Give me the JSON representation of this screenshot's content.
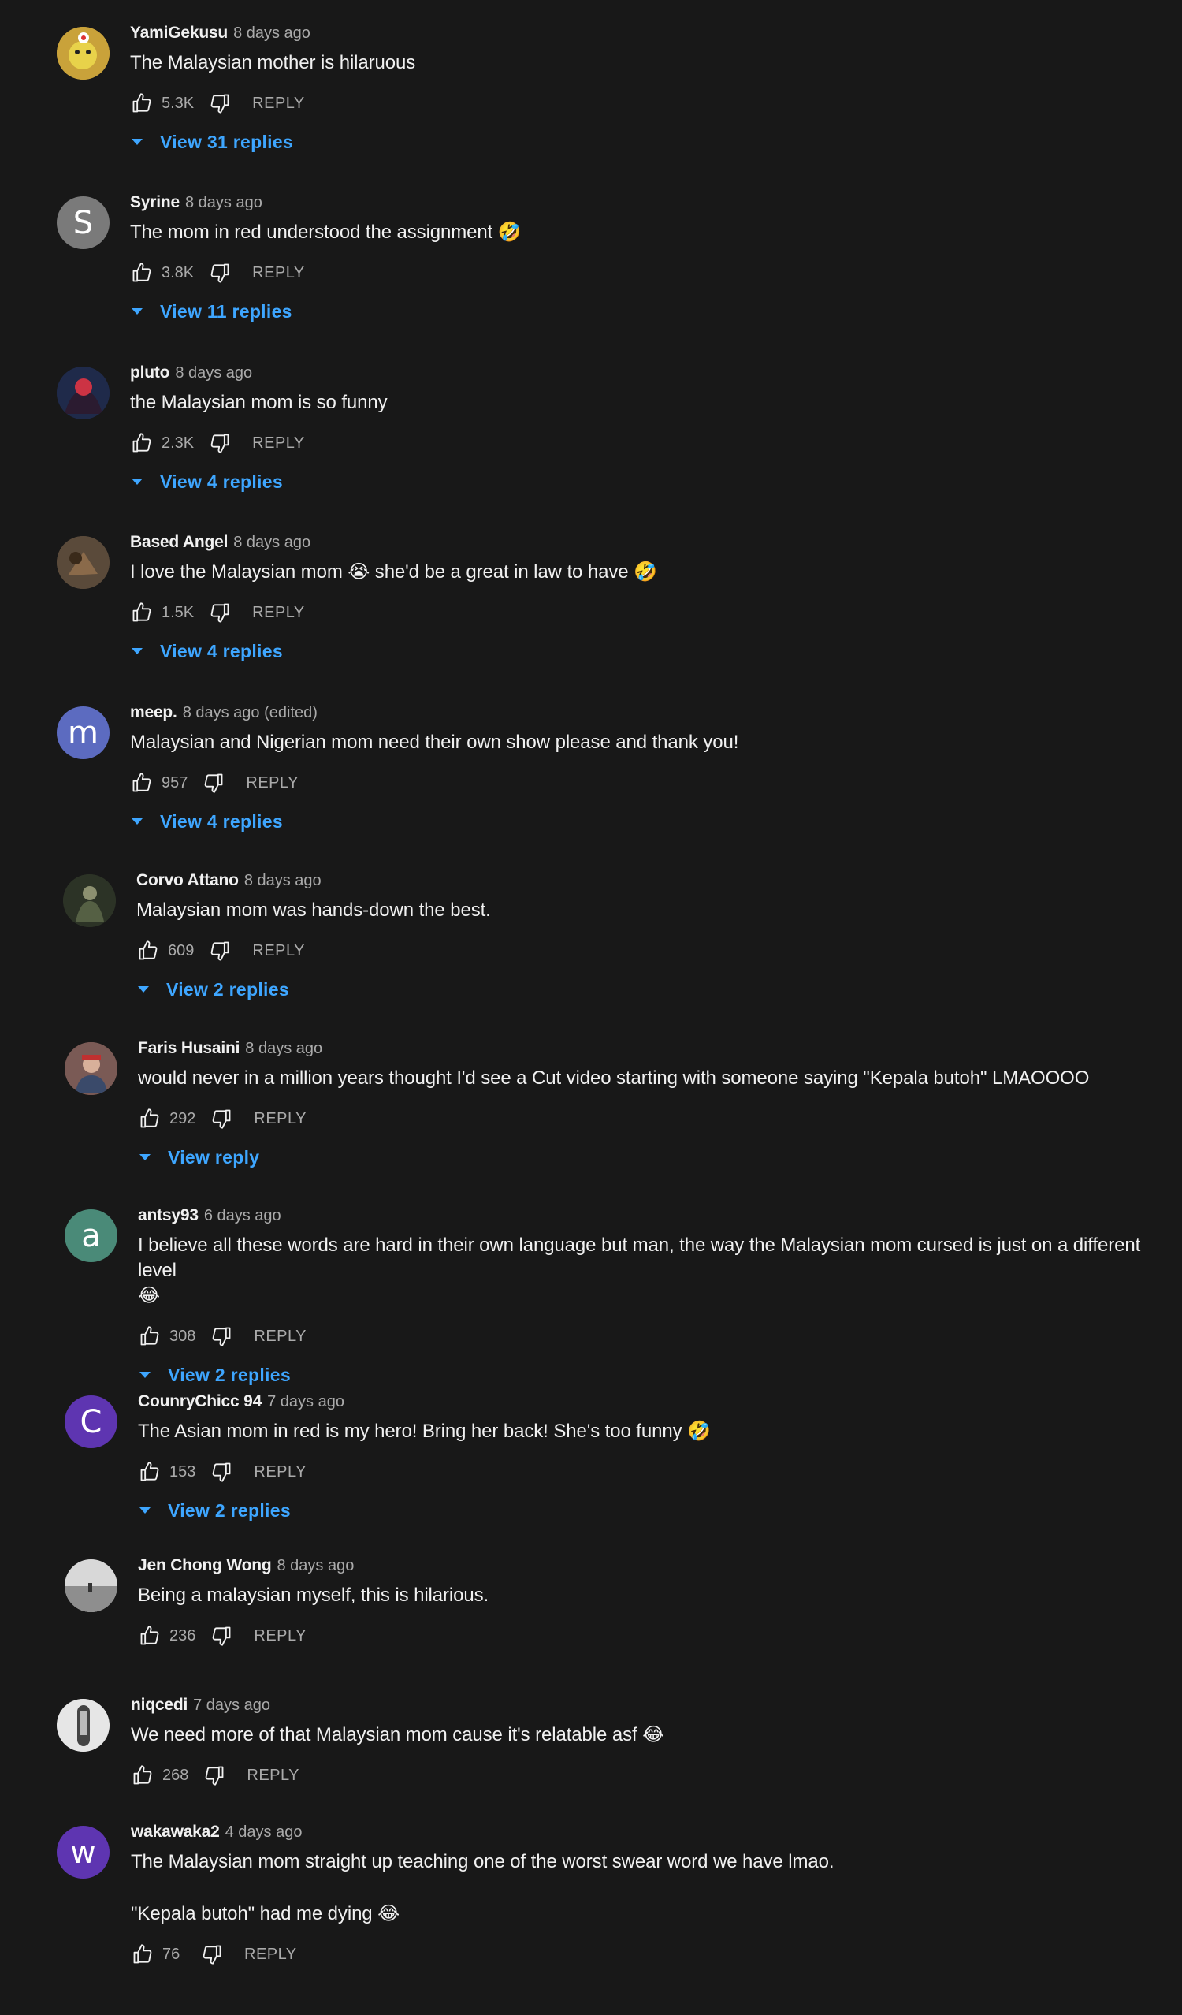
{
  "comments": [
    {
      "author": "YamiGekusu",
      "time": "8 days ago",
      "text": [
        "The Malaysian mother is hilaruous"
      ],
      "likes": "5.3K",
      "reply": "REPLY",
      "view_replies": "View 31 replies",
      "avatar": {
        "type": "image",
        "bg": "#c9a23a",
        "name": "avatar-image"
      }
    },
    {
      "author": "Syrine",
      "time": "8 days ago",
      "text": [
        "The mom in red understood the assignment"
      ],
      "emoji": "🤣",
      "likes": "3.8K",
      "reply": "REPLY",
      "view_replies": "View 11 replies",
      "avatar": {
        "type": "letter",
        "letter": "S",
        "bg": "#7a7a7a"
      }
    },
    {
      "author": "pluto",
      "time": "8 days ago",
      "text": [
        "the Malaysian mom is so funny"
      ],
      "likes": "2.3K",
      "reply": "REPLY",
      "view_replies": "View 4 replies",
      "avatar": {
        "type": "image",
        "bg": "#1f2a4a",
        "name": "avatar-image"
      }
    },
    {
      "author": "Based Angel",
      "time": "8 days ago",
      "text": [
        "I love the Malaysian mom 😭 she'd be a great in law to have"
      ],
      "emoji": "🤣",
      "likes": "1.5K",
      "reply": "REPLY",
      "view_replies": "View 4 replies",
      "avatar": {
        "type": "image",
        "bg": "#5a4a3a",
        "name": "avatar-image"
      }
    },
    {
      "author": "meep.",
      "time": "8 days ago (edited)",
      "text": [
        "Malaysian and Nigerian mom need their own show please and thank you!"
      ],
      "likes": "957",
      "reply": "REPLY",
      "view_replies": "View 4 replies",
      "avatar": {
        "type": "letter",
        "letter": "m",
        "bg": "#5c6bc0"
      }
    },
    {
      "author": "Corvo Attano",
      "time": "8 days ago",
      "text": [
        "Malaysian mom was hands-down the best."
      ],
      "likes": "609",
      "reply": "REPLY",
      "view_replies": "View 2 replies",
      "avatar": {
        "type": "image",
        "bg": "#2c3326",
        "name": "avatar-image"
      }
    },
    {
      "author": "Faris Husaini",
      "time": "8 days ago",
      "text": [
        "would never in a million years thought I'd see a Cut video starting with someone saying \"Kepala butoh\" LMAOOOO"
      ],
      "likes": "292",
      "reply": "REPLY",
      "view_replies": "View reply",
      "avatar": {
        "type": "image",
        "bg": "#7a5a55",
        "name": "avatar-image"
      }
    },
    {
      "author": "antsy93",
      "time": "6 days ago",
      "text": [
        "I believe all these words are hard in their own language but man, the way the Malaysian mom cursed is just on a different level"
      ],
      "emoji": "😂",
      "emoji_newline": true,
      "likes": "308",
      "reply": "REPLY",
      "view_replies": "View 2 replies",
      "avatar": {
        "type": "letter",
        "letter": "a",
        "bg": "#4a8a78"
      }
    },
    {
      "author": "CounryChicc 94",
      "time": "7 days ago",
      "text": [
        "The Asian mom in red is my hero! Bring her back! She's too funny"
      ],
      "emoji": "🤣",
      "likes": "153",
      "reply": "REPLY",
      "view_replies": "View 2 replies",
      "avatar": {
        "type": "letter",
        "letter": "C",
        "bg": "#5e35b1"
      }
    },
    {
      "author": "Jen Chong Wong",
      "time": "8 days ago",
      "text": [
        "Being a malaysian myself, this is hilarious."
      ],
      "likes": "236",
      "reply": "REPLY",
      "view_replies": "",
      "avatar": {
        "type": "image",
        "bg": "#9a9a9a",
        "name": "avatar-image"
      }
    },
    {
      "author": "niqcedi",
      "time": "7 days ago",
      "text": [
        "We need more of that Malaysian mom cause it's relatable asf"
      ],
      "emoji": "😂",
      "likes": "268",
      "reply": "REPLY",
      "view_replies": "",
      "avatar": {
        "type": "image",
        "bg": "#bdbdbd",
        "name": "avatar-image"
      }
    },
    {
      "author": "wakawaka2",
      "time": "4 days ago",
      "text": [
        "The Malaysian mom straight up teaching one of the worst swear word we have lmao.",
        "\"Kepala butoh\" had me dying"
      ],
      "emoji": "😂",
      "likes": "76",
      "reply": "REPLY",
      "view_replies": "",
      "avatar": {
        "type": "letter",
        "letter": "w",
        "bg": "#5e35b1"
      }
    }
  ],
  "colors": {
    "background": "#181818",
    "text": "#f1f1f1",
    "muted": "#aaaaaa",
    "link": "#3ea6ff"
  },
  "icons": {
    "like": "thumbs-up-icon",
    "dislike": "thumbs-down-icon",
    "expand": "caret-down-icon"
  }
}
